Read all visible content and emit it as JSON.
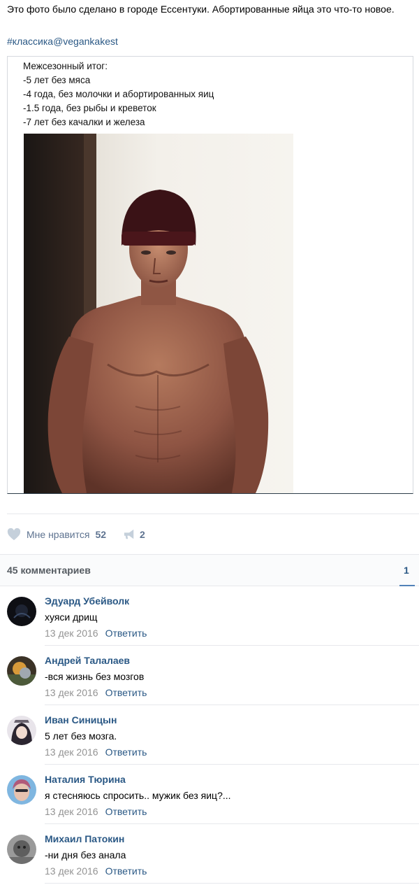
{
  "post": {
    "text": "Это фото было сделано в городе Ессентуки. Абортированные яйца это что-то новое.",
    "hashtag": "#классика@vegankakest",
    "image_caption": {
      "lines": [
        "Межсезонный итог:",
        "-5 лет без мяса",
        "-4 года, без молочки и абортированных яиц",
        "-1.5 года, без рыбы и креветок",
        "-7 лет без качалки и железа"
      ]
    }
  },
  "actions": {
    "like_label": "Мне нравится",
    "like_count": "52",
    "share_count": "2",
    "like_icon": "heart-icon",
    "share_icon": "megaphone-icon"
  },
  "comments_header": {
    "count_label": "45 комментариев",
    "page": "1"
  },
  "comments": [
    {
      "author": "Эдуард Убейволк",
      "text": "хуяси дрищ",
      "date": "13 дек 2016",
      "reply": "Ответить"
    },
    {
      "author": "Андрей Талалаев",
      "text": "-вся жизнь без мозгов",
      "date": "13 дек 2016",
      "reply": "Ответить"
    },
    {
      "author": "Иван Синицын",
      "text": "5 лет без мозга.",
      "date": "13 дек 2016",
      "reply": "Ответить"
    },
    {
      "author": "Наталия Тюрина",
      "text": "я стесняюсь спросить.. мужик без яиц?...",
      "date": "13 дек 2016",
      "reply": "Ответить"
    },
    {
      "author": "Михаил Патокин",
      "text": "-ни дня без анала",
      "date": "13 дек 2016",
      "reply": "Ответить"
    }
  ],
  "colors": {
    "link": "#2a5885",
    "muted": "#939393",
    "action": "#5e7390"
  }
}
